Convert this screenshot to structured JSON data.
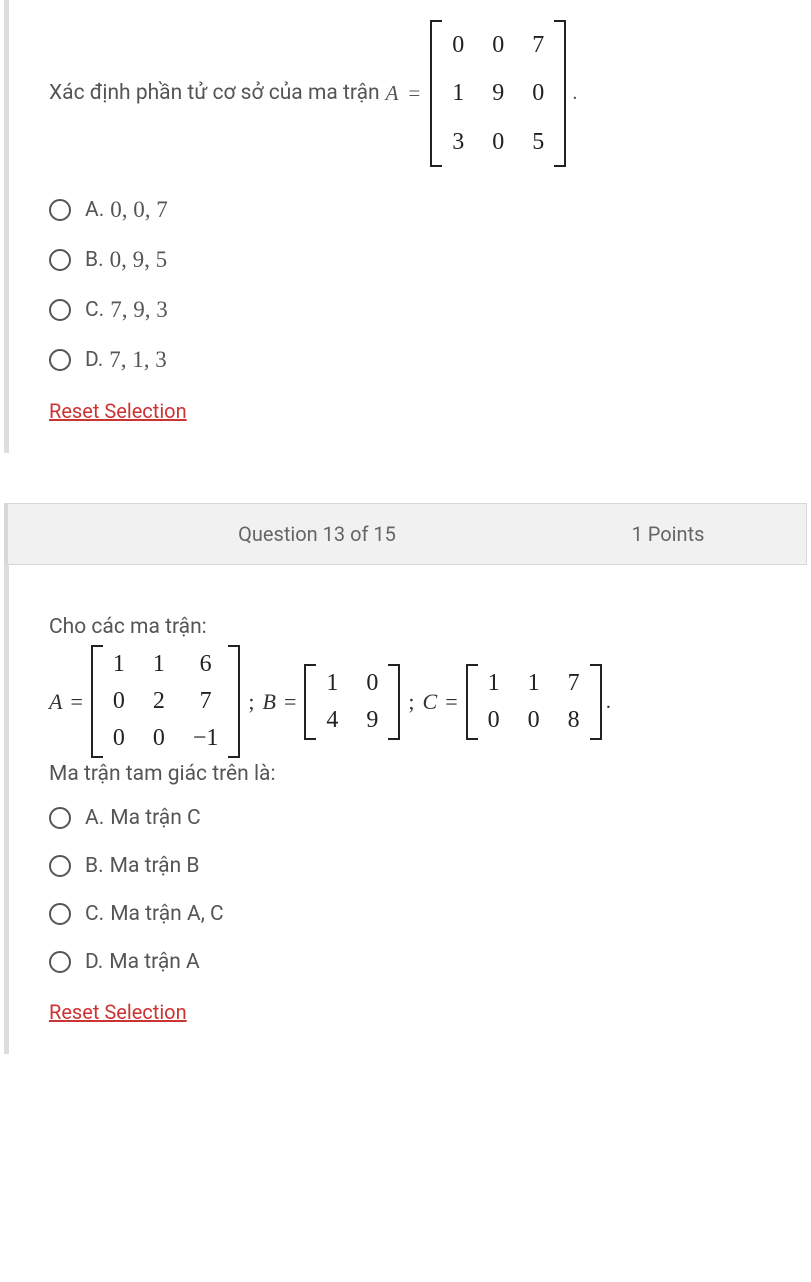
{
  "q12": {
    "prompt_prefix": "Xác định phần tử cơ sở của ma trận ",
    "matrix_var": "A",
    "matrix": [
      [
        "0",
        "0",
        "7"
      ],
      [
        "1",
        "9",
        "0"
      ],
      [
        "3",
        "0",
        "5"
      ]
    ],
    "period": ".",
    "options": [
      {
        "letter": "A.",
        "value": "0, 0, 7"
      },
      {
        "letter": "B.",
        "value": "0, 9, 5"
      },
      {
        "letter": "C.",
        "value": "7, 9, 3"
      },
      {
        "letter": "D.",
        "value": "7, 1, 3"
      }
    ],
    "reset": "Reset Selection"
  },
  "header": {
    "title": "Question 13 of 15",
    "points": "1 Points"
  },
  "q13": {
    "intro": "Cho các ma trận:",
    "varA": "A",
    "matA": [
      [
        "1",
        "1",
        "6"
      ],
      [
        "0",
        "2",
        "7"
      ],
      [
        "0",
        "0",
        "−1"
      ]
    ],
    "varB": "B",
    "matB": [
      [
        "1",
        "0"
      ],
      [
        "4",
        "9"
      ]
    ],
    "varC": "C",
    "matC": [
      [
        "1",
        "1",
        "7"
      ],
      [
        "0",
        "0",
        "8"
      ]
    ],
    "period": ".",
    "sub_prompt": "Ma trận tam giác trên là:",
    "options": [
      {
        "letter": "A.",
        "value": "Ma trận C"
      },
      {
        "letter": "B.",
        "value": "Ma trận B"
      },
      {
        "letter": "C.",
        "value": "Ma trận A, C"
      },
      {
        "letter": "D.",
        "value": "Ma trận A"
      }
    ],
    "reset": "Reset Selection"
  }
}
